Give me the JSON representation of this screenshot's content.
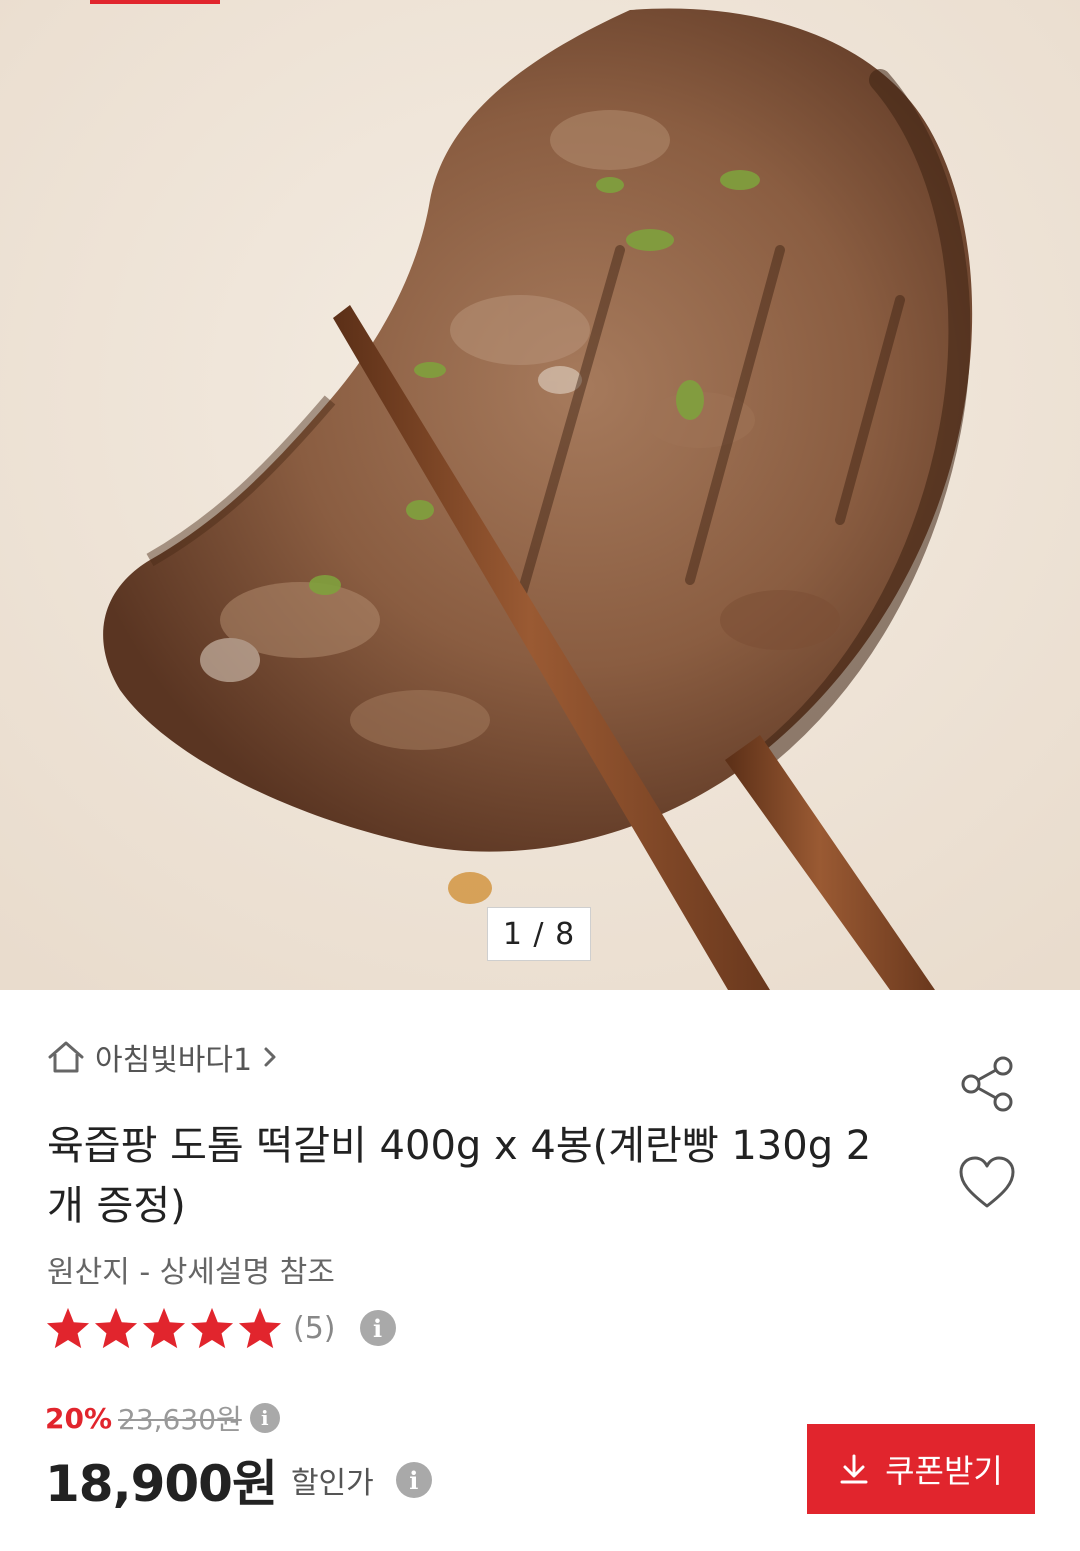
{
  "gallery": {
    "current": "1",
    "separator": "/",
    "total": "8",
    "counter_text": "1 / 8"
  },
  "seller": {
    "name": "아침빛바다1",
    "home_icon": "home-icon",
    "chevron_icon": "chevron-right-icon"
  },
  "product": {
    "title": "육즙팡 도톰 떡갈비 400g x 4봉(계란빵 130g 2개 증정)",
    "origin": "원산지 - 상세설명 참조"
  },
  "rating": {
    "stars": 5,
    "max_stars": 5,
    "review_count": "(5)",
    "info_icon": "i"
  },
  "price": {
    "discount_rate": "20%",
    "original": "23,630원",
    "sale": "18,900원",
    "sale_label": "할인가",
    "info_icon": "i"
  },
  "actions": {
    "coupon_label": "쿠폰받기",
    "share_icon": "share-icon",
    "like_icon": "heart-icon"
  },
  "colors": {
    "accent": "#e1252d",
    "star": "#e1252d",
    "info_icon_bg": "#a9a9a9",
    "hero_bg": "#efe4d7"
  }
}
